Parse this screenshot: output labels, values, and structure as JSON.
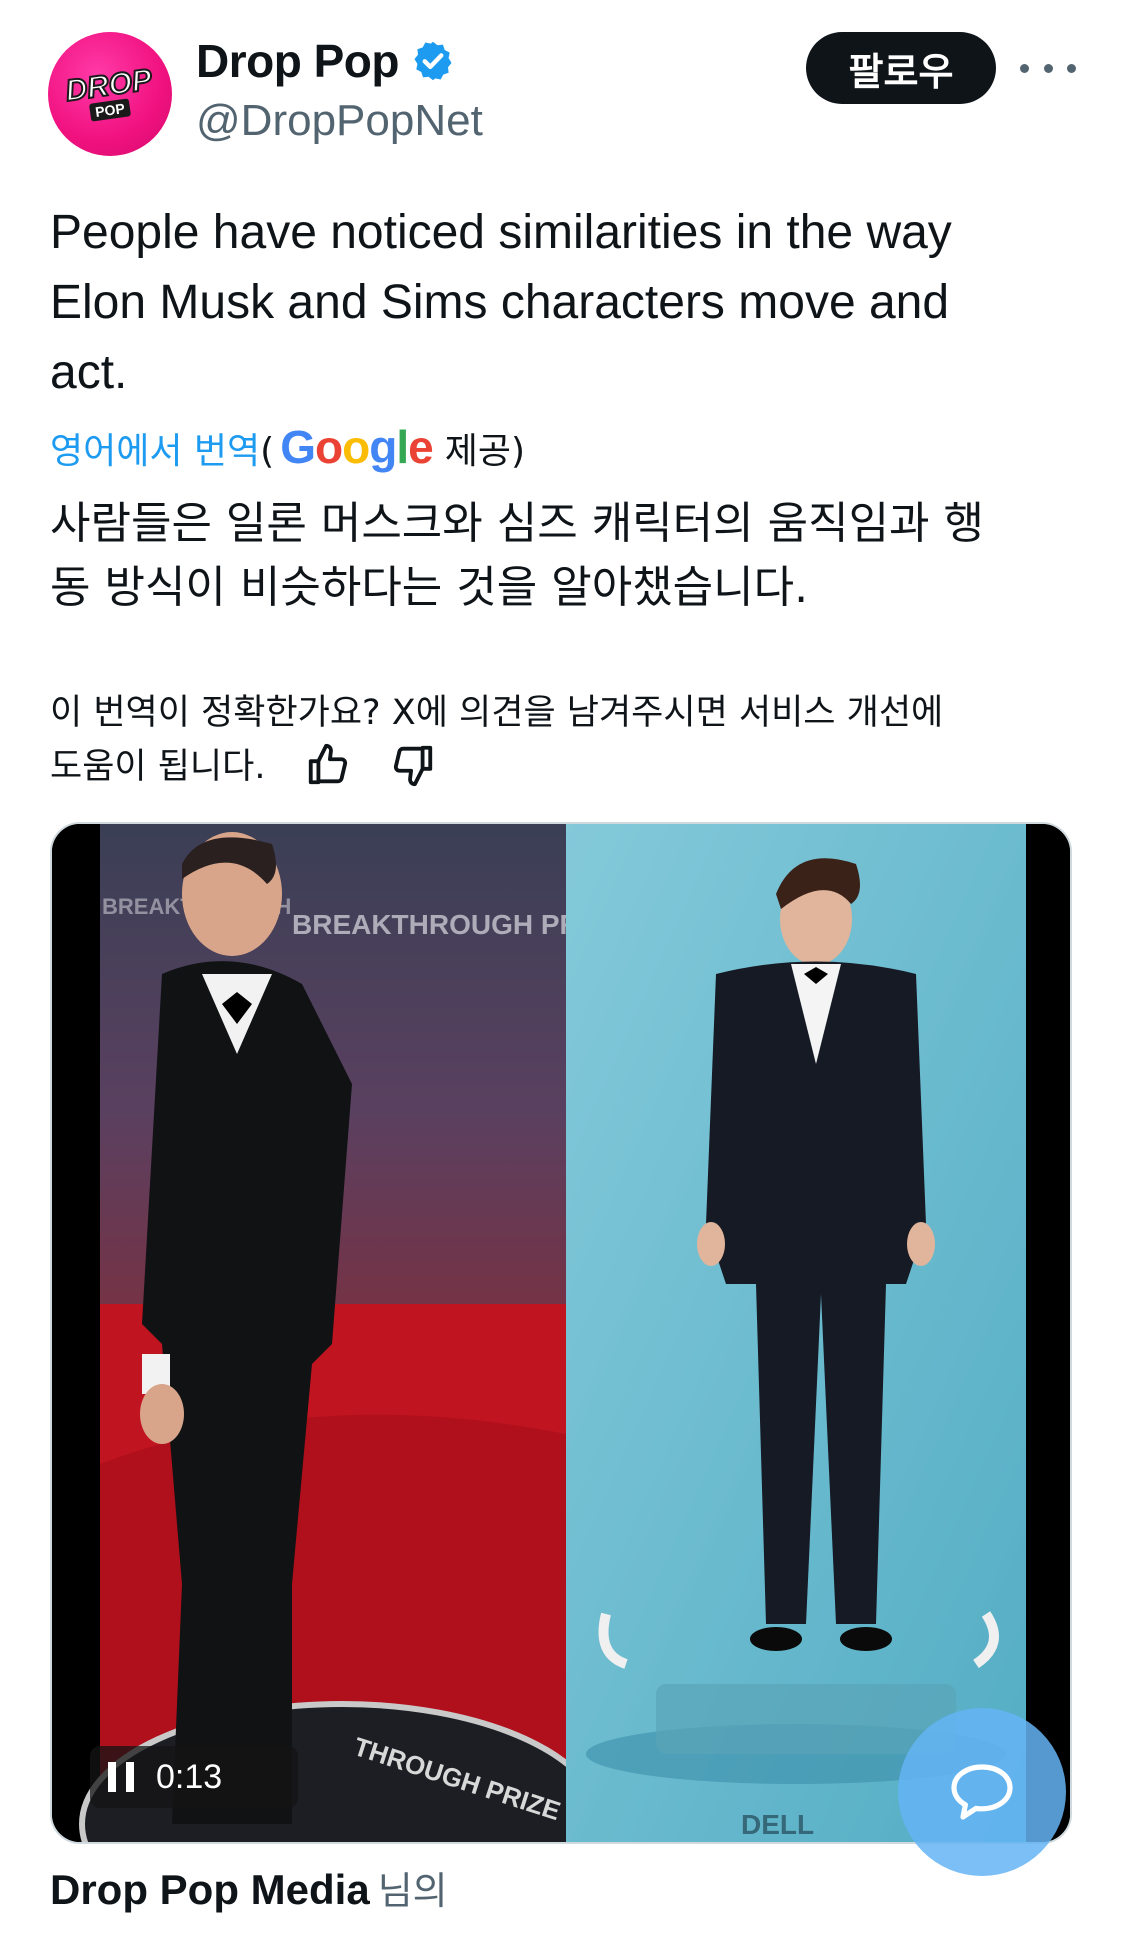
{
  "header": {
    "logo_text_top": "DROP",
    "logo_text_bottom": "POP",
    "display_name": "Drop Pop",
    "handle": "@DropPopNet",
    "follow_label": "팔로우",
    "brand_color": "#f0117f",
    "verified_color": "#1d9bf0"
  },
  "tweet": {
    "lines": [
      "People have noticed similarities in the way",
      "Elon Musk and Sims characters move and",
      "act."
    ]
  },
  "translation": {
    "link_label": "영어에서 번역",
    "open_paren": "(",
    "provider_letters": [
      "G",
      "o",
      "o",
      "g",
      "l",
      "e"
    ],
    "provided_label": "제공)",
    "lines": [
      "사람들은 일론 머스크와 심즈 캐릭터의 움직임과 행",
      "동 방식이 비슷하다는 것을 알아챘습니다."
    ],
    "feedback_line1": "이 번역이 정확한가요? X에 의견을 남겨주시면 서비스 개선에",
    "feedback_line2": "도움이 됩니다."
  },
  "media": {
    "timecode": "0:13",
    "left_backdrop_text": "BREAKTHROUGH PRIZE",
    "left_floor_text": "THROUGH PRIZE",
    "right_floor_text": "DELL"
  },
  "source": {
    "org": "Drop Pop Media",
    "suffix": "님의"
  }
}
